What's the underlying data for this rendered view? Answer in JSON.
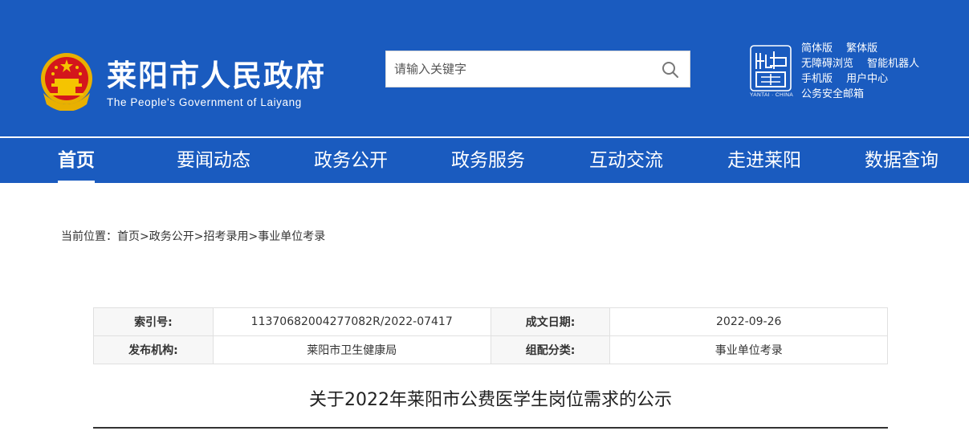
{
  "header": {
    "title": "莱阳市人民政府",
    "subtitle": "The People's Government of Laiyang",
    "emblem_icon": "national-emblem-icon",
    "background_color": "#1a5bbf"
  },
  "search": {
    "placeholder": "请输入关键字",
    "icon": "search-icon"
  },
  "china_logo": {
    "icon": "china-seal-logo-icon",
    "caption": "YANTAI · CHINA"
  },
  "util_links": [
    [
      "简体版",
      "繁体版"
    ],
    [
      "无障碍浏览",
      "智能机器人"
    ],
    [
      "手机版",
      "用户中心"
    ],
    [
      "公务安全邮箱"
    ]
  ],
  "nav": {
    "items": [
      "首页",
      "要闻动态",
      "政务公开",
      "政务服务",
      "互动交流",
      "走进莱阳",
      "数据查询"
    ],
    "active": "首页"
  },
  "breadcrumb": {
    "prefix": "当前位置：",
    "items": [
      "首页",
      "政务公开",
      "招考录用",
      "事业单位考录"
    ],
    "separator": ">"
  },
  "meta": {
    "index_label": "索引号:",
    "index_value": "11370682004277082R/2022-07417",
    "date_label": "成文日期:",
    "date_value": "2022-09-26",
    "publisher_label": "发布机构:",
    "publisher_value": "莱阳市卫生健康局",
    "category_label": "组配分类:",
    "category_value": "事业单位考录"
  },
  "article": {
    "title": "关于2022年莱阳市公费医学生岗位需求的公示"
  }
}
